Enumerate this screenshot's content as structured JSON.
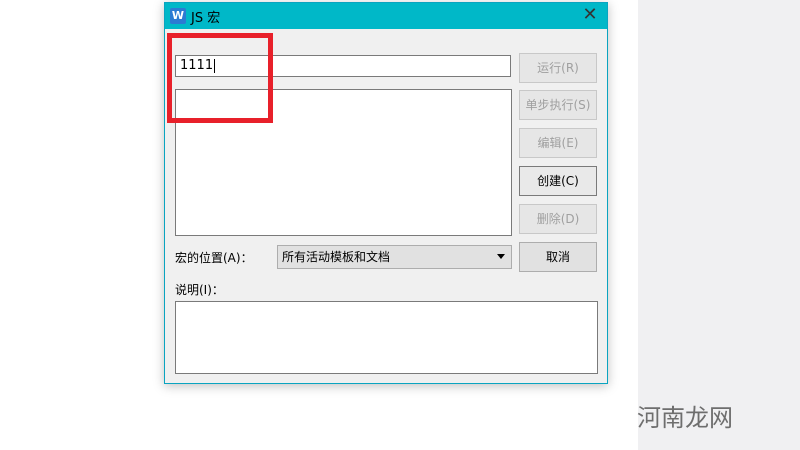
{
  "dialog": {
    "title": "JS 宏",
    "app_icon_letter": "W",
    "close_glyph": "✕"
  },
  "name_field": {
    "value": "1111"
  },
  "buttons": {
    "run": "运行(R)",
    "step": "单步执行(S)",
    "edit": "编辑(E)",
    "create": "创建(C)",
    "delete": "删除(D)",
    "cancel": "取消"
  },
  "location": {
    "label": "宏的位置(A)：",
    "selected": "所有活动模板和文档"
  },
  "description": {
    "label": "说明(I)："
  },
  "watermark": "河南龙网",
  "colors": {
    "titlebar": "#00b8c8",
    "highlight_box": "#e8202a"
  }
}
